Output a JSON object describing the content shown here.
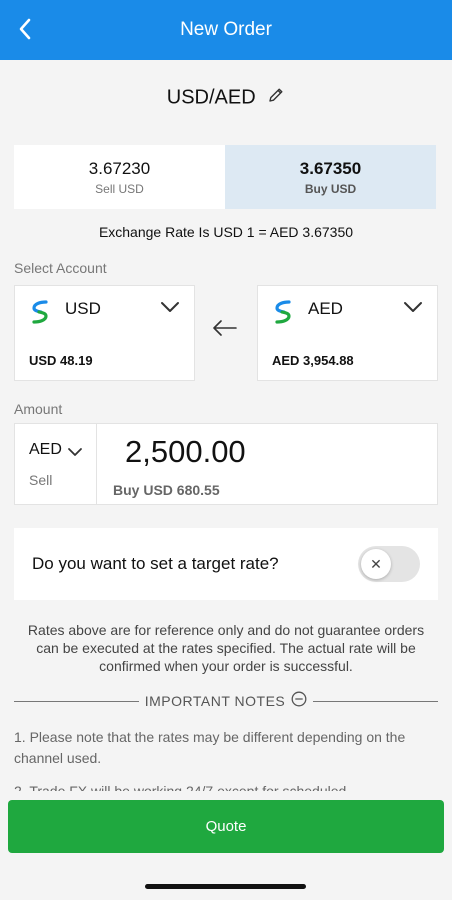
{
  "header": {
    "title": "New Order"
  },
  "pair": {
    "label": "USD/AED"
  },
  "rates": {
    "sell": {
      "value": "3.67230",
      "label": "Sell USD"
    },
    "buy": {
      "value": "3.67350",
      "label": "Buy USD"
    }
  },
  "exchange_text": "Exchange Rate Is USD 1 = AED 3.67350",
  "select_account": {
    "label": "Select Account",
    "from": {
      "currency": "USD",
      "balance": "USD 48.19"
    },
    "to": {
      "currency": "AED",
      "balance": "AED 3,954.88"
    }
  },
  "amount": {
    "label": "Amount",
    "currency": "AED",
    "side": "Sell",
    "value": "2,500.00",
    "buy_text": "Buy  USD 680.55"
  },
  "target": {
    "question": "Do you want to set a target rate?",
    "enabled": false
  },
  "disclaimer": "Rates above are for reference only and do not guarantee orders can be executed at the rates specified. The actual rate will be confirmed when your order is successful.",
  "notes": {
    "title": "IMPORTANT NOTES",
    "items": [
      "1. Please note that the rates may be different depending on the channel used.",
      "2. Trade FX will be working 24/7 except for scheduled"
    ]
  },
  "quote_button": "Quote",
  "colors": {
    "header": "#1a8be8",
    "active_rate": "#dde9f3",
    "quote": "#1fa83f"
  },
  "icons": [
    "back-chevron-icon",
    "edit-pencil-icon",
    "bank-logo-icon",
    "chevron-down-icon",
    "arrow-left-icon",
    "close-icon",
    "minus-circle-icon"
  ]
}
